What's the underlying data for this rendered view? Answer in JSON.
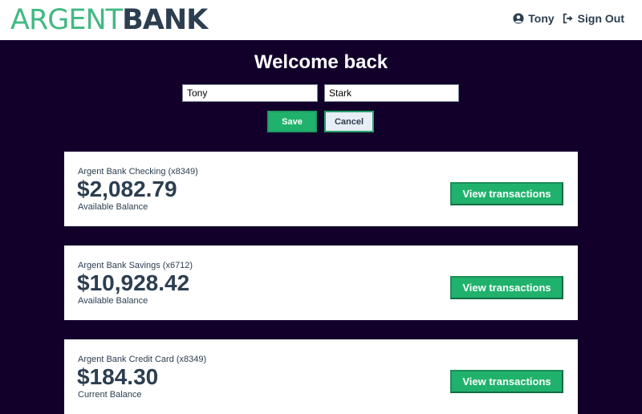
{
  "brand": {
    "part1": "ARGENT",
    "part2": "BANK"
  },
  "nav": {
    "user_name": "Tony",
    "sign_out": "Sign Out"
  },
  "header": {
    "title": "Welcome back",
    "first_name_value": "Tony",
    "last_name_value": "Stark",
    "save_label": "Save",
    "cancel_label": "Cancel"
  },
  "accounts": [
    {
      "title": "Argent Bank Checking (x8349)",
      "amount": "$2,082.79",
      "description": "Available Balance",
      "button": "View transactions"
    },
    {
      "title": "Argent Bank Savings (x6712)",
      "amount": "$10,928.42",
      "description": "Available Balance",
      "button": "View transactions"
    },
    {
      "title": "Argent Bank Credit Card (x8349)",
      "amount": "$184.30",
      "description": "Current Balance",
      "button": "View transactions"
    }
  ],
  "colors": {
    "accent": "#20b26c",
    "dark": "#2c3e50",
    "background": "#12002b"
  },
  "icons": {
    "user": "user-circle-icon",
    "sign_out": "sign-out-icon"
  }
}
